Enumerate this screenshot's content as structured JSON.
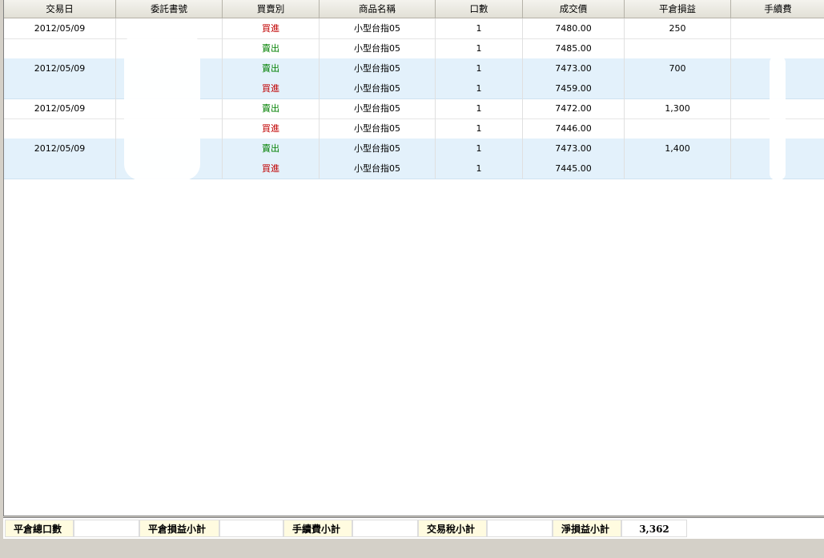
{
  "table": {
    "headers": [
      "交易日",
      "委託書號",
      "買賣別",
      "商品名稱",
      "口數",
      "成交價",
      "平倉損益",
      "手續費"
    ],
    "rows": [
      {
        "date": "2012/05/09",
        "order": "",
        "side": "買進",
        "side_type": "buy",
        "product": "小型台指05",
        "qty": "1",
        "price": "7480.00",
        "pnl": "250",
        "fee": ""
      },
      {
        "date": "",
        "order": "",
        "side": "賣出",
        "side_type": "sell",
        "product": "小型台指05",
        "qty": "1",
        "price": "7485.00",
        "pnl": "",
        "fee": ""
      },
      {
        "date": "2012/05/09",
        "order": "",
        "side": "賣出",
        "side_type": "sell",
        "product": "小型台指05",
        "qty": "1",
        "price": "7473.00",
        "pnl": "700",
        "fee": ""
      },
      {
        "date": "",
        "order": "",
        "side": "買進",
        "side_type": "buy",
        "product": "小型台指05",
        "qty": "1",
        "price": "7459.00",
        "pnl": "",
        "fee": ""
      },
      {
        "date": "2012/05/09",
        "order": "",
        "side": "賣出",
        "side_type": "sell",
        "product": "小型台指05",
        "qty": "1",
        "price": "7472.00",
        "pnl": "1,300",
        "fee": ""
      },
      {
        "date": "",
        "order": "",
        "side": "買進",
        "side_type": "buy",
        "product": "小型台指05",
        "qty": "1",
        "price": "7446.00",
        "pnl": "",
        "fee": ""
      },
      {
        "date": "2012/05/09",
        "order": "",
        "side": "賣出",
        "side_type": "sell",
        "product": "小型台指05",
        "qty": "1",
        "price": "7473.00",
        "pnl": "1,400",
        "fee": ""
      },
      {
        "date": "",
        "order": "",
        "side": "買進",
        "side_type": "buy",
        "product": "小型台指05",
        "qty": "1",
        "price": "7445.00",
        "pnl": "",
        "fee": ""
      }
    ]
  },
  "summary": {
    "close_qty_label": "平倉總口數",
    "close_qty_value": "",
    "close_pnl_label": "平倉損益小計",
    "close_pnl_value": "",
    "fee_label": "手續費小計",
    "fee_value": "",
    "tax_label": "交易稅小計",
    "tax_value": "",
    "net_label": "淨損益小計",
    "net_value": "3,362"
  },
  "colors": {
    "buy": "#c00000",
    "sell": "#008000",
    "alt_row": "#e3f1fb",
    "summary_label_bg": "#fffbe0"
  }
}
